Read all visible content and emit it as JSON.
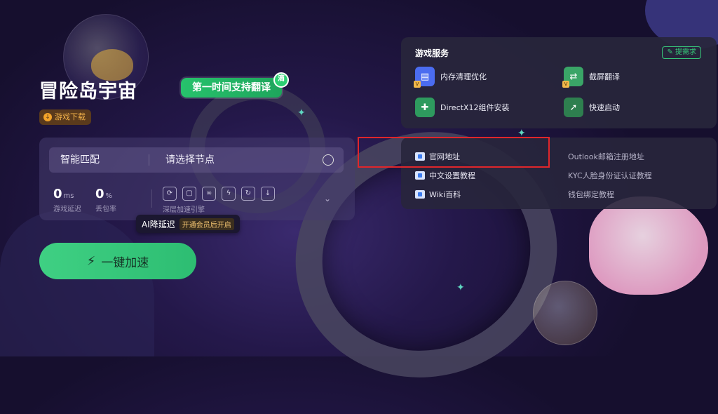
{
  "game": {
    "title": "冒险岛宇宙",
    "translate_badge": "第一时间支持翻译",
    "translate_badge_mini": "滴",
    "download_label": "游戏下载"
  },
  "accelerator": {
    "mode": "智能匹配",
    "node_placeholder": "请选择节点",
    "latency_value": "0",
    "latency_unit": "ms",
    "latency_label": "游戏延迟",
    "loss_value": "0",
    "loss_unit": "%",
    "loss_label": "丢包率",
    "deep_engine_label": "深层加速引擎",
    "ai_tooltip_text": "AI降延迟",
    "ai_tooltip_tag": "开通会员后开启",
    "button_label": "一键加速"
  },
  "services": {
    "title": "游戏服务",
    "request_label": "提需求",
    "items": [
      {
        "label": "内存清理优化",
        "icon": "memory-clean-icon"
      },
      {
        "label": "截屏翻译",
        "icon": "screenshot-translate-icon"
      },
      {
        "label": "DirectX12组件安装",
        "icon": "directx-install-icon"
      },
      {
        "label": "快速启动",
        "icon": "quick-launch-icon"
      }
    ]
  },
  "links": {
    "left": [
      {
        "label": "官网地址"
      },
      {
        "label": "中文设置教程"
      },
      {
        "label": "Wiki百科"
      }
    ],
    "right": [
      {
        "label": "Outlook邮箱注册地址"
      },
      {
        "label": "KYC人脸身份证认证教程"
      },
      {
        "label": "钱包绑定教程"
      }
    ]
  },
  "colors": {
    "accent_green": "#3fd083",
    "highlight_red": "#e0262b",
    "background": "#24184a"
  }
}
